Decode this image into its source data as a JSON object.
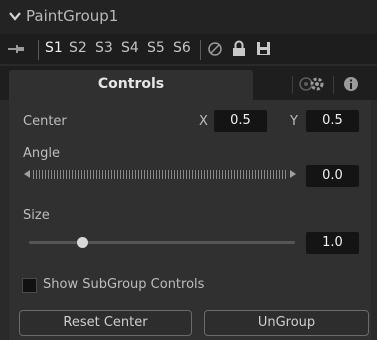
{
  "header": {
    "title": "PaintGroup1"
  },
  "toolbar": {
    "slots": [
      "S1",
      "S2",
      "S3",
      "S4",
      "S5",
      "S6"
    ],
    "active_slot": "S1"
  },
  "tabs": {
    "controls_label": "Controls"
  },
  "controls": {
    "center": {
      "label": "Center",
      "x_label": "X",
      "x_value": "0.5",
      "y_label": "Y",
      "y_value": "0.5"
    },
    "angle": {
      "label": "Angle",
      "value": "0.0"
    },
    "size": {
      "label": "Size",
      "value": "1.0",
      "slider_fraction": 0.2
    },
    "show_subgroup": {
      "label": "Show SubGroup Controls",
      "checked": false
    },
    "buttons": {
      "reset_center": "Reset Center",
      "ungroup": "UnGroup"
    }
  },
  "colors": {
    "background": "#2a2a2a",
    "panel": "#303030",
    "field": "#141414",
    "text": "#c8c8c8"
  },
  "icons": [
    "chevron-down-icon",
    "pin-icon",
    "disable-icon",
    "lock-icon",
    "save-icon",
    "modifiers-icon",
    "settings-icon",
    "info-icon"
  ]
}
